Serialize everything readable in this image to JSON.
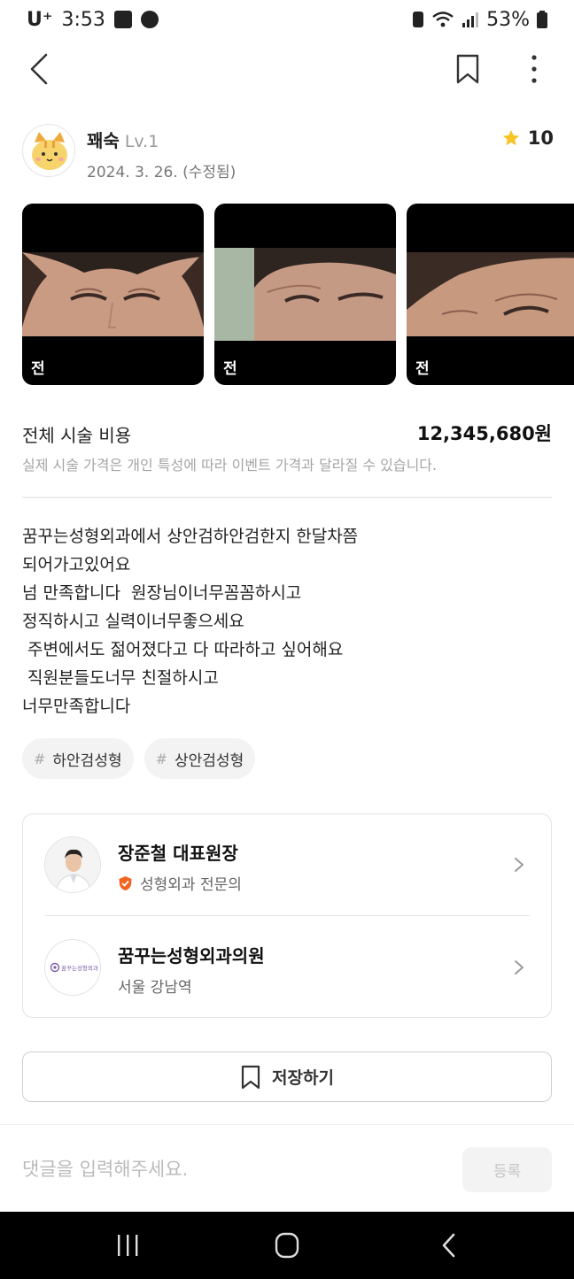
{
  "status_bar": {
    "carrier": "U⁺",
    "time": "3:53",
    "battery": "53%"
  },
  "author": {
    "name": "꽤숙",
    "level": "Lv.1",
    "date": "2024. 3. 26. (수정됨)",
    "rating": "10"
  },
  "photos": [
    {
      "label": "전"
    },
    {
      "label": "전"
    },
    {
      "label": "전"
    }
  ],
  "cost": {
    "label": "전체 시술 비용",
    "value": "12,345,680원",
    "note": "실제 시술 가격은 개인 특성에 따라 이벤트 가격과 달라질 수 있습니다."
  },
  "review": {
    "lines": [
      "꿈꾸는성형외과에서 상안검하안검한지 한달차쯤",
      "되어가고있어요",
      "넘 만족합니다  원장님이너무꼼꼼하시고",
      "정직하시고 실력이너무좋으세요",
      " 주변에서도 젊어졌다고 다 따라하고 싶어해요",
      " 직원분들도너무 친절하시고",
      "너무만족합니다"
    ]
  },
  "tags": [
    {
      "hash": "#",
      "label": "하안검성형"
    },
    {
      "hash": "#",
      "label": "상안검성형"
    }
  ],
  "doctor": {
    "name": "장준철 대표원장",
    "specialty": "성형외과 전문의"
  },
  "clinic": {
    "name": "꿈꾸는성형외과의원",
    "location": "서울 강남역",
    "logo_text": "꿈꾸는성형외과"
  },
  "save_label": "저장하기",
  "comment": {
    "placeholder": "댓글을 입력해주세요.",
    "submit_label": "등록"
  },
  "colors": {
    "star": "#f7c325",
    "verified": "#f26522",
    "clinic_logo": "#7a5aa8"
  }
}
